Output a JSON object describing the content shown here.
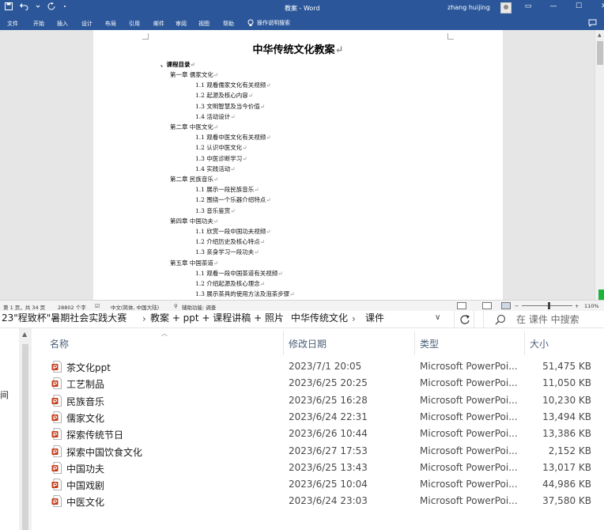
{
  "word": {
    "doc_title": "教案 - Word",
    "user_name": "zhang huijing",
    "tabs": [
      "文件",
      "开始",
      "插入",
      "设计",
      "布局",
      "引用",
      "邮件",
      "审阅",
      "视图",
      "帮助"
    ],
    "tell_me": "操作说明搜索",
    "document": {
      "heading": "中华传统文化教案",
      "toc_title": "、课程目录",
      "chapters": [
        {
          "title": "第一章  儒家文化",
          "items": [
            "1.1 观看儒家文化有关视频",
            "1.2 起源及核心内容",
            "1.3 文明智慧及当今价值",
            "1.4 活动设计"
          ]
        },
        {
          "title": "第二章  中医文化",
          "items": [
            "1.1 观看中医文化有关视频",
            "1.2 认识中医文化",
            "1.3 中医诊断学习",
            "1.4 实践活动"
          ]
        },
        {
          "title": "第二章  民族音乐",
          "items": [
            "1.1  展示一段民族音乐",
            "1.2  围绕一个乐器介绍特点",
            "1.3 音乐鉴赏"
          ]
        },
        {
          "title": "第四章  中国功夫",
          "items": [
            "1.1  欣赏一段中国功夫视频",
            "1.2  介绍历史及核心特点",
            "1.3  亲身学习一段功夫"
          ]
        },
        {
          "title": "第五章  中国茶道",
          "items": [
            "1.1  观看一段中国茶道有关视频",
            "1.2  介绍起源及核心理念",
            "1.3  展示茶具的使用方法及泡茶步骤"
          ]
        }
      ]
    },
    "status": {
      "page": "第 1 页，共 34 页",
      "words": "28802 个字",
      "language": "中文(简体, 中国大陆)",
      "accessibility": "辅助功能: 调查",
      "zoom": "110%"
    }
  },
  "explorer": {
    "breadcrumb": [
      "23\"程致杯\"暑期社会实践大赛",
      "教案 + ppt + 课程讲稿 + 照片",
      "中华传统文化",
      "课件"
    ],
    "search_placeholder": "在 课件 中搜索",
    "nav_clipped_text": "间",
    "columns": {
      "name": "名称",
      "date": "修改日期",
      "type": "类型",
      "size": "大小"
    },
    "files": [
      {
        "name": "茶文化ppt",
        "date": "2023/7/1 20:05",
        "type": "Microsoft PowerPoi...",
        "size": "51,475 KB"
      },
      {
        "name": "工艺制品",
        "date": "2023/6/25 20:25",
        "type": "Microsoft PowerPoi...",
        "size": "11,050 KB"
      },
      {
        "name": "民族音乐",
        "date": "2023/6/25 16:28",
        "type": "Microsoft PowerPoi...",
        "size": "10,230 KB"
      },
      {
        "name": "儒家文化",
        "date": "2023/6/24 22:31",
        "type": "Microsoft PowerPoi...",
        "size": "13,494 KB"
      },
      {
        "name": "探索传统节日",
        "date": "2023/6/26 10:44",
        "type": "Microsoft PowerPoi...",
        "size": "13,386 KB"
      },
      {
        "name": "探索中国饮食文化",
        "date": "2023/6/27 17:53",
        "type": "Microsoft PowerPoi...",
        "size": "2,152 KB"
      },
      {
        "name": "中国功夫",
        "date": "2023/6/25 13:43",
        "type": "Microsoft PowerPoi...",
        "size": "13,017 KB"
      },
      {
        "name": "中国戏剧",
        "date": "2023/6/25 10:04",
        "type": "Microsoft PowerPoi...",
        "size": "44,986 KB"
      },
      {
        "name": "中医文化",
        "date": "2023/6/24 23:03",
        "type": "Microsoft PowerPoi...",
        "size": "37,580 KB"
      }
    ],
    "ppt_icon_color": "#c43e1c"
  },
  "colors": {
    "word_blue": "#2b579a",
    "explorer_header": "#4c607a"
  }
}
